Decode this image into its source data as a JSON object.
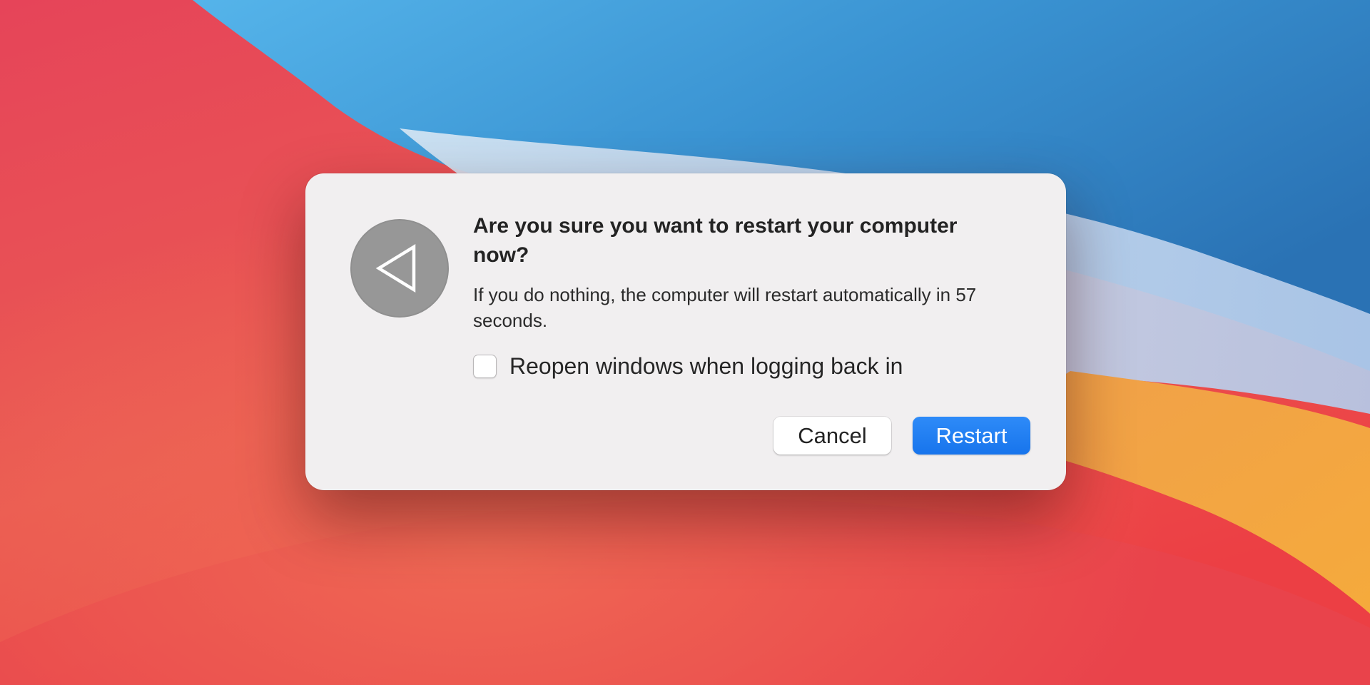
{
  "dialog": {
    "title": "Are you sure you want to restart your computer now?",
    "message": "If you do nothing, the computer will restart automatically in 57 seconds.",
    "reopen_windows": {
      "label": "Reopen windows when logging back in",
      "checked": false
    },
    "buttons": {
      "cancel_label": "Cancel",
      "restart_label": "Restart"
    },
    "icon": "restart-triangle-icon"
  },
  "colors": {
    "dialog_background": "#f1eff0",
    "primary_button": "#1e7ff0",
    "icon_circle": "#979797"
  }
}
